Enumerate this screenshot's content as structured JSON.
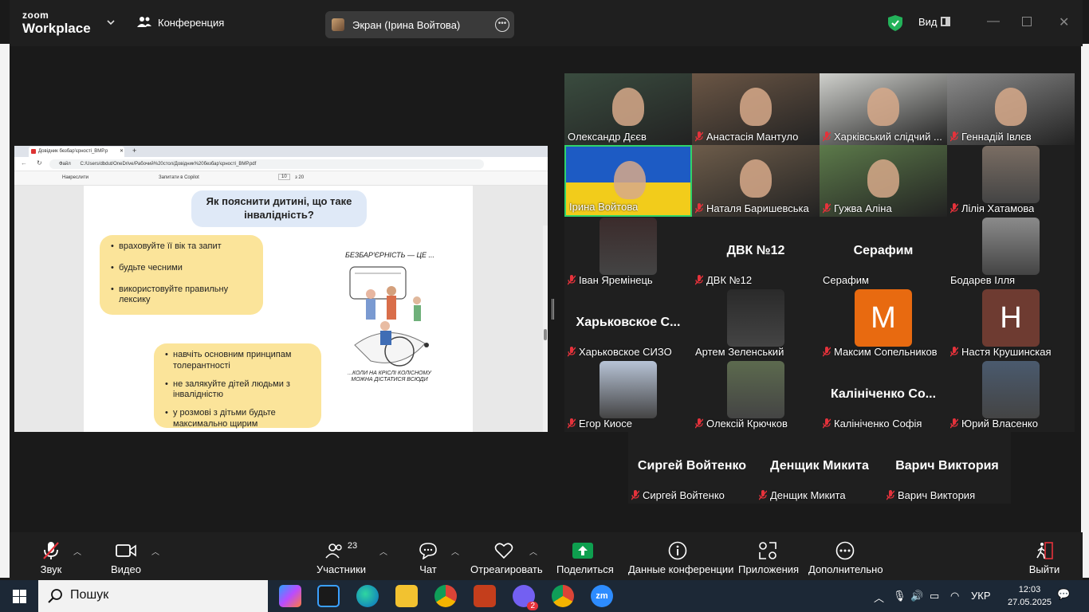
{
  "topbar": {
    "logo_top": "zoom",
    "logo_bottom": "Workplace",
    "conference_tab": "Конференция",
    "share_label": "Экран (Ірина Войтова)",
    "view_label": "Вид"
  },
  "shared_screen": {
    "browser_tab": "Довідник безбар'єрності_ВМР.p",
    "address_prefix": "Файл",
    "address": "C:/Users/dbdut/OneDrive/Рабочий%20стол/Довідник%20безбар'єрності_ВМР.pdf",
    "toolbar_draw": "Накреслити",
    "toolbar_copilot": "Запитати в Copilot",
    "page_num": "10",
    "page_total": "з 20",
    "slide_title": "Як пояснити дитині, що таке інвалідність?",
    "bullets_top": [
      "враховуйте її вік та запит",
      "будьте чесними",
      "використовуйте правильну лексику"
    ],
    "bullets_bottom": [
      "навчіть основним принципам толерантності",
      "не залякуйте дітей людьми з інвалідністю",
      "у розмові з дітьми будьте максимально щирим"
    ],
    "illus_caption_top": "БЕЗБАР'ЄРНІСТЬ — ЦЕ ...",
    "illus_caption_bottom": "...КОЛИ НА КРІСЛІ КОЛІСНОМУ МОЖНА ДІСТАТИСЯ ВСЮДИ"
  },
  "participants": [
    {
      "name": "Олександр Дєєв",
      "muted": false,
      "kind": "video"
    },
    {
      "name": "Анастасія Мантуло",
      "muted": true,
      "kind": "video"
    },
    {
      "name": "Харківський слідчий ...",
      "muted": true,
      "kind": "video"
    },
    {
      "name": "Геннадій Івлєв",
      "muted": true,
      "kind": "video"
    },
    {
      "name": "Ірина Войтова",
      "muted": false,
      "kind": "video",
      "active": true
    },
    {
      "name": "Наталя Баришевська",
      "muted": true,
      "kind": "video"
    },
    {
      "name": "Гужва Аліна",
      "muted": true,
      "kind": "video"
    },
    {
      "name": "Лілія Хатамова",
      "muted": true,
      "kind": "photo"
    },
    {
      "name": "Іван Яремінець",
      "muted": true,
      "kind": "photo"
    },
    {
      "name": "ДВК №12",
      "muted": true,
      "kind": "text",
      "big": "ДВК №12"
    },
    {
      "name": "Серафим",
      "muted": false,
      "kind": "text",
      "big": "Серафим"
    },
    {
      "name": "Бодарев Ілля",
      "muted": false,
      "kind": "photo"
    },
    {
      "name": "Харьковское СИЗО",
      "muted": true,
      "kind": "text",
      "big": "Харьковское С..."
    },
    {
      "name": "Артем Зеленський",
      "muted": false,
      "kind": "photo"
    },
    {
      "name": "Максим Сопельников",
      "muted": true,
      "kind": "letter",
      "letter": "M"
    },
    {
      "name": "Настя Крушинская",
      "muted": true,
      "kind": "letter",
      "letter": "H"
    },
    {
      "name": "Егор Киосе",
      "muted": true,
      "kind": "photo"
    },
    {
      "name": "Олексій Крючков",
      "muted": true,
      "kind": "photo"
    },
    {
      "name": "Калініченко Софія",
      "muted": true,
      "kind": "text",
      "big": "Калініченко Со..."
    },
    {
      "name": "Юрий Власенко",
      "muted": true,
      "kind": "photo"
    },
    {
      "name": "Сиргей Войтенко",
      "muted": true,
      "kind": "text",
      "big": "Сиргей Войтенко"
    },
    {
      "name": "Денщик Микита",
      "muted": true,
      "kind": "text",
      "big": "Денщик Микита"
    },
    {
      "name": "Варич Виктория",
      "muted": true,
      "kind": "text",
      "big": "Варич Виктория"
    }
  ],
  "toolbar": {
    "audio": "Звук",
    "video": "Видео",
    "participants": "Участники",
    "participants_count": "23",
    "chat": "Чат",
    "react": "Отреагировать",
    "share": "Поделиться",
    "info": "Данные конференции",
    "apps": "Приложения",
    "more": "Дополнительно",
    "leave": "Выйти"
  },
  "taskbar": {
    "search": "Пошук",
    "lang": "УКР",
    "time": "12:03",
    "date": "27.05.2025",
    "viber_badge": "2"
  },
  "colors": {
    "accent_green": "#2fd36a",
    "share_green": "#0e9f4f",
    "muted_red": "#e5323b",
    "avatar_orange": "#e86a10",
    "avatar_brown": "#6e3b31"
  }
}
